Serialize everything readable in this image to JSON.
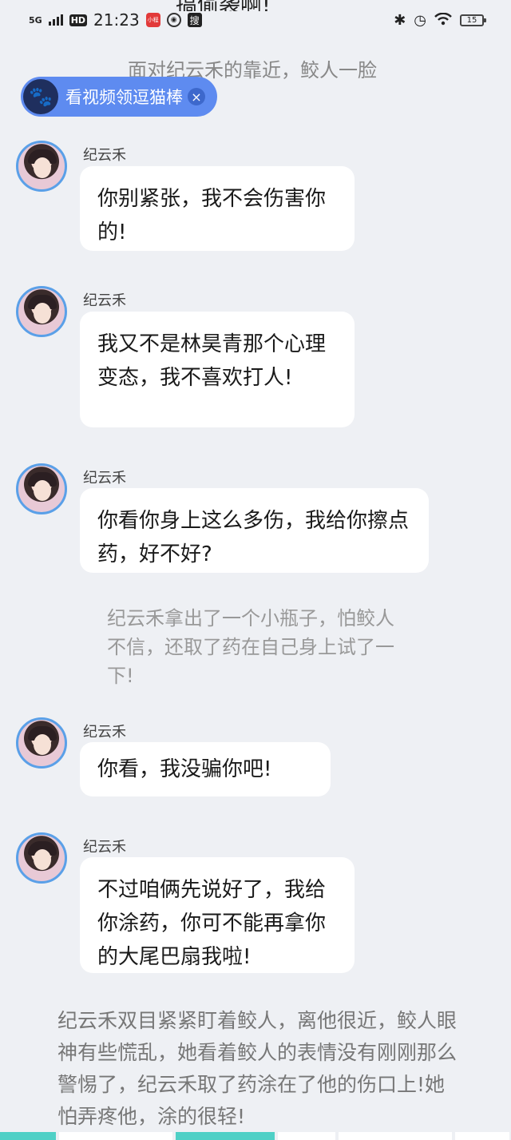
{
  "status_bar": {
    "network": "5G",
    "hd": "HD",
    "time": "21:23",
    "app_badge": "小程",
    "search_label": "搜",
    "battery": "15"
  },
  "top_cut_text": "搞偷袭啊!",
  "top_narration": "面对纪云禾的靠近，鲛人一脸警惕",
  "promo": {
    "label": "看视频领逗猫棒",
    "close": "×"
  },
  "messages": [
    {
      "sender": "纪云禾",
      "text": "你别紧张，我不会伤害你的!"
    },
    {
      "sender": "纪云禾",
      "text": "我又不是林昊青那个心理变态，我不喜欢打人!"
    },
    {
      "sender": "纪云禾",
      "text": "你看你身上这么多伤，我给你擦点药，好不好?"
    },
    {
      "sender": "纪云禾",
      "text": "你看，我没骗你吧!"
    },
    {
      "sender": "纪云禾",
      "text": "不过咱俩先说好了，我给你涂药，你可不能再拿你的大尾巴扇我啦!"
    }
  ],
  "narration_middle": "纪云禾拿出了一个小瓶子，怕鲛人不信，还取了药在自己身上试了一下!",
  "narration_bottom": "纪云禾双目紧紧盯着鲛人，离他很近，鲛人眼神有些慌乱，她看着鲛人的表情没有刚刚那么警惕了，纪云禾取了药涂在了他的伤口上!她怕弄疼他，涂的很轻!",
  "colors": {
    "background": "#eef0f4",
    "promo": "#5e8bf0",
    "avatar_ring": "#5aa0e8",
    "progress": "#4fd0c6"
  }
}
